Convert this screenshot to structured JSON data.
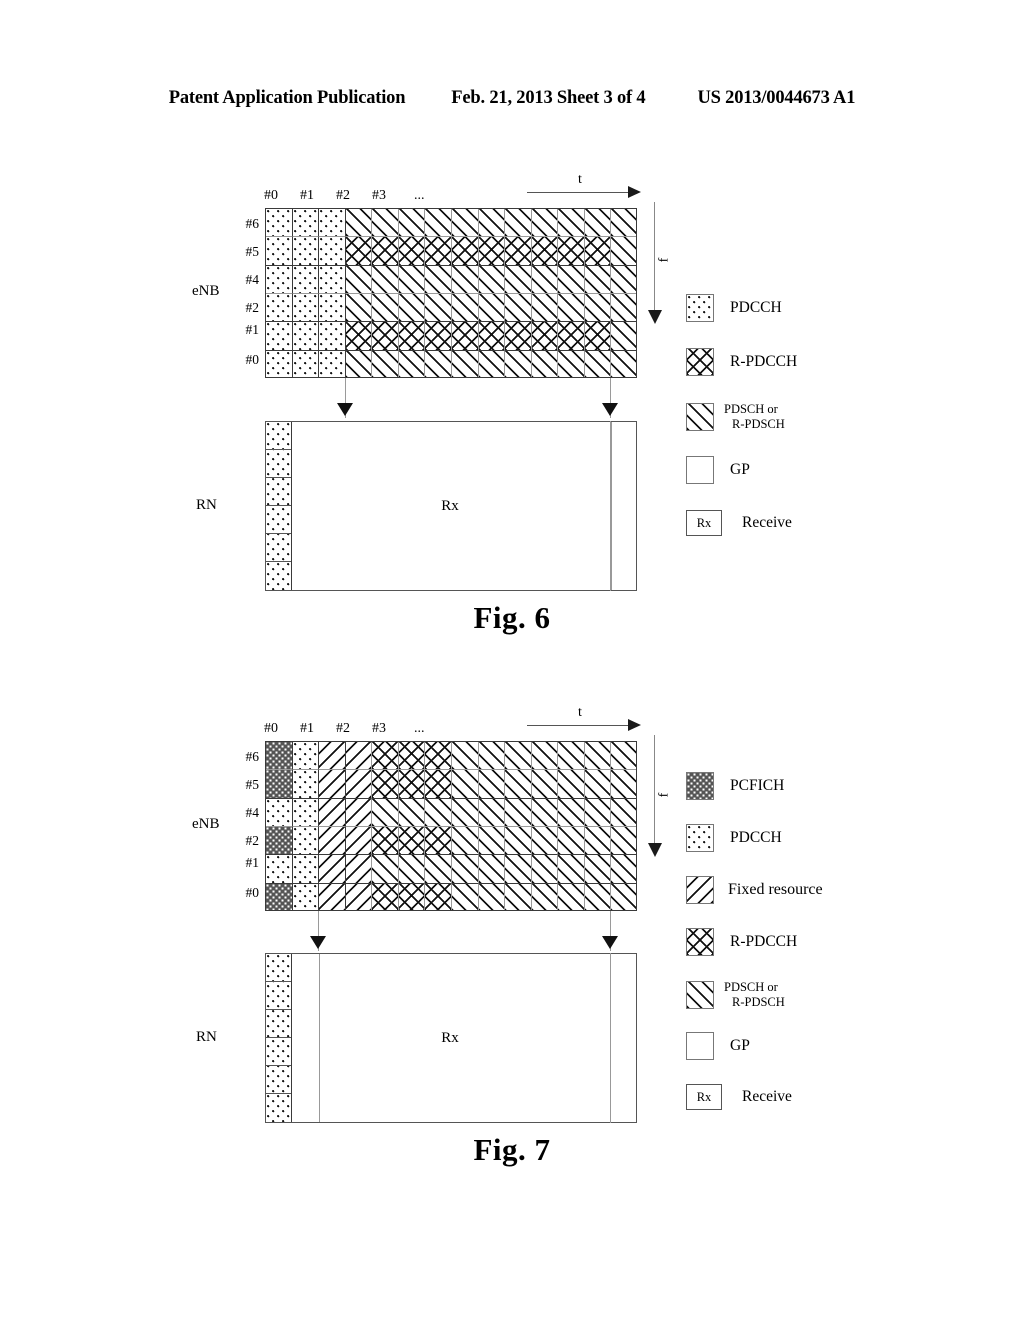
{
  "page": {
    "header": {
      "left": "Patent Application Publication",
      "middle": "Feb. 21, 2013  Sheet 3 of 4",
      "right": "US 2013/0044673 A1"
    }
  },
  "figures": [
    {
      "id": "fig6",
      "caption": "Fig. 6",
      "axes": {
        "time_label": "t",
        "freq_label": "f"
      },
      "column_headers": [
        "#0",
        "#1",
        "#2",
        "#3",
        "..."
      ],
      "row_labels": [
        "#6",
        "#5",
        "#4",
        "#2",
        "#1",
        "#0"
      ],
      "enb_label": "eNB",
      "rn_label": "RN",
      "rx_label": "Rx",
      "grid": {
        "columns": 14,
        "rows": 6,
        "cells": [
          [
            "pdcch",
            "pdcch",
            "pdcch",
            "pdsch",
            "pdsch",
            "pdsch",
            "pdsch",
            "pdsch",
            "pdsch",
            "pdsch",
            "pdsch",
            "pdsch",
            "pdsch",
            "pdsch"
          ],
          [
            "pdcch",
            "pdcch",
            "pdcch",
            "rpdcch",
            "rpdcch",
            "rpdcch",
            "rpdcch",
            "rpdcch",
            "rpdcch",
            "rpdcch",
            "rpdcch",
            "rpdcch",
            "rpdcch",
            "pdsch"
          ],
          [
            "pdcch",
            "pdcch",
            "pdcch",
            "pdsch",
            "pdsch",
            "pdsch",
            "pdsch",
            "pdsch",
            "pdsch",
            "pdsch",
            "pdsch",
            "pdsch",
            "pdsch",
            "pdsch"
          ],
          [
            "pdcch",
            "pdcch",
            "pdcch",
            "pdsch",
            "pdsch",
            "pdsch",
            "pdsch",
            "pdsch",
            "pdsch",
            "pdsch",
            "pdsch",
            "pdsch",
            "pdsch",
            "pdsch"
          ],
          [
            "pdcch",
            "pdcch",
            "pdcch",
            "rpdcch",
            "rpdcch",
            "rpdcch",
            "rpdcch",
            "rpdcch",
            "rpdcch",
            "rpdcch",
            "rpdcch",
            "rpdcch",
            "rpdcch",
            "pdsch"
          ],
          [
            "pdcch",
            "pdcch",
            "pdcch",
            "pdsch",
            "pdsch",
            "pdsch",
            "pdsch",
            "pdsch",
            "pdsch",
            "pdsch",
            "pdsch",
            "pdsch",
            "pdsch",
            "pdsch"
          ]
        ]
      },
      "legend": [
        {
          "pattern": "pdcch",
          "label": "PDCCH"
        },
        {
          "pattern": "rpdcch",
          "label": "R-PDCCH"
        },
        {
          "pattern": "pdsch",
          "label": "PDSCH  or",
          "label2": "R-PDSCH"
        },
        {
          "pattern": "gp",
          "label": "GP"
        },
        {
          "pattern": "rx",
          "label": "Receive",
          "box_text": "Rx"
        }
      ]
    },
    {
      "id": "fig7",
      "caption": "Fig. 7",
      "axes": {
        "time_label": "t",
        "freq_label": "f"
      },
      "column_headers": [
        "#0",
        "#1",
        "#2",
        "#3",
        "..."
      ],
      "row_labels": [
        "#6",
        "#5",
        "#4",
        "#2",
        "#1",
        "#0"
      ],
      "enb_label": "eNB",
      "rn_label": "RN",
      "rx_label": "Rx",
      "grid": {
        "columns": 14,
        "rows": 6,
        "cells": [
          [
            "pcfich",
            "pdcch",
            "fixed",
            "fixed",
            "rpdcch",
            "rpdcch",
            "rpdcch",
            "pdsch",
            "pdsch",
            "pdsch",
            "pdsch",
            "pdsch",
            "pdsch",
            "pdsch"
          ],
          [
            "pcfich",
            "pdcch",
            "fixed",
            "fixed",
            "rpdcch",
            "rpdcch",
            "rpdcch",
            "pdsch",
            "pdsch",
            "pdsch",
            "pdsch",
            "pdsch",
            "pdsch",
            "pdsch"
          ],
          [
            "pdcch",
            "pdcch",
            "fixed",
            "fixed",
            "pdsch",
            "pdsch",
            "pdsch",
            "pdsch",
            "pdsch",
            "pdsch",
            "pdsch",
            "pdsch",
            "pdsch",
            "pdsch"
          ],
          [
            "pcfich",
            "pdcch",
            "fixed",
            "fixed",
            "rpdcch",
            "rpdcch",
            "rpdcch",
            "pdsch",
            "pdsch",
            "pdsch",
            "pdsch",
            "pdsch",
            "pdsch",
            "pdsch"
          ],
          [
            "pdcch",
            "pdcch",
            "fixed",
            "fixed",
            "pdsch",
            "pdsch",
            "pdsch",
            "pdsch",
            "pdsch",
            "pdsch",
            "pdsch",
            "pdsch",
            "pdsch",
            "pdsch"
          ],
          [
            "pcfich",
            "pdcch",
            "fixed",
            "fixed",
            "rpdcch",
            "rpdcch",
            "rpdcch",
            "pdsch",
            "pdsch",
            "pdsch",
            "pdsch",
            "pdsch",
            "pdsch",
            "pdsch"
          ]
        ]
      },
      "legend": [
        {
          "pattern": "pcfich",
          "label": "PCFICH"
        },
        {
          "pattern": "pdcch",
          "label": "PDCCH"
        },
        {
          "pattern": "fixed",
          "label": "Fixed resource"
        },
        {
          "pattern": "rpdcch",
          "label": "R-PDCCH"
        },
        {
          "pattern": "pdsch",
          "label": "PDSCH  or",
          "label2": "R-PDSCH"
        },
        {
          "pattern": "gp",
          "label": "GP"
        },
        {
          "pattern": "rx",
          "label": "Receive",
          "box_text": "Rx"
        }
      ]
    }
  ]
}
